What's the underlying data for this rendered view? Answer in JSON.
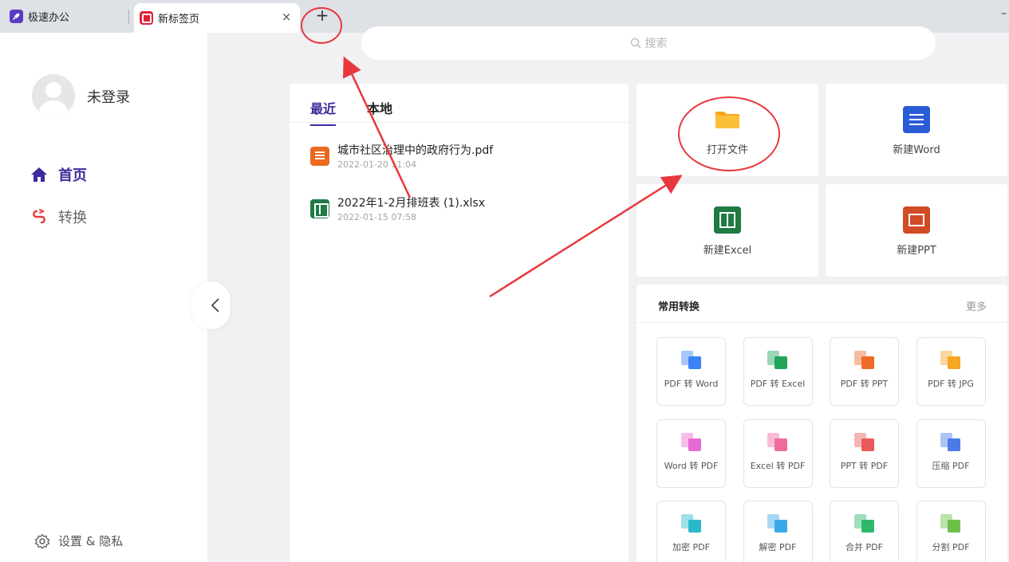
{
  "tabs": [
    {
      "label": "极速办公",
      "icon": "rocket-icon"
    },
    {
      "label": "新标签页",
      "icon": "new-tab-icon",
      "close": "×"
    }
  ],
  "tab_add": "+",
  "window_min": "–",
  "sidebar": {
    "username": "未登录",
    "nav": [
      {
        "label": "首页",
        "icon": "home-icon"
      },
      {
        "label": "转换",
        "icon": "convert-icon"
      }
    ],
    "settings_label": "设置 & 隐私"
  },
  "search": {
    "placeholder": "搜索"
  },
  "recent": {
    "tabs": [
      "最近",
      "本地"
    ],
    "files": [
      {
        "name": "城市社区治理中的政府行为.pdf",
        "date": "2022-01-20 11:04",
        "type": "pdf"
      },
      {
        "name": "2022年1-2月排班表 (1).xlsx",
        "date": "2022-01-15 07:58",
        "type": "xlsx"
      }
    ]
  },
  "actions": [
    {
      "label": "打开文件",
      "icon": "folder-icon"
    },
    {
      "label": "新建Word",
      "icon": "word-icon"
    },
    {
      "label": "新建Excel",
      "icon": "excel-icon"
    },
    {
      "label": "新建PPT",
      "icon": "ppt-icon"
    }
  ],
  "conversions": {
    "title": "常用转换",
    "more": "更多",
    "items": [
      {
        "label": "PDF 转 Word",
        "icon": "pdf-to-word-icon",
        "color": "#3b82f6"
      },
      {
        "label": "PDF 转 Excel",
        "icon": "pdf-to-excel-icon",
        "color": "#22a55a"
      },
      {
        "label": "PDF 转 PPT",
        "icon": "pdf-to-ppt-icon",
        "color": "#f06a2a"
      },
      {
        "label": "PDF 转 JPG",
        "icon": "pdf-to-jpg-icon",
        "color": "#f5a623"
      },
      {
        "label": "Word 转 PDF",
        "icon": "word-to-pdf-icon",
        "color": "#e86bd4"
      },
      {
        "label": "Excel 转 PDF",
        "icon": "excel-to-pdf-icon",
        "color": "#f06aa0"
      },
      {
        "label": "PPT 转 PDF",
        "icon": "ppt-to-pdf-icon",
        "color": "#e85a5a"
      },
      {
        "label": "压缩 PDF",
        "icon": "compress-pdf-icon",
        "color": "#4a7be8"
      },
      {
        "label": "加密 PDF",
        "icon": "encrypt-pdf-icon",
        "color": "#2ab8c8"
      },
      {
        "label": "解密 PDF",
        "icon": "decrypt-pdf-icon",
        "color": "#3aa8e8"
      },
      {
        "label": "合并 PDF",
        "icon": "merge-pdf-icon",
        "color": "#2db86a"
      },
      {
        "label": "分割 PDF",
        "icon": "split-pdf-icon",
        "color": "#6cc04a"
      }
    ]
  },
  "colors": {
    "brand": "#3e2a9c",
    "annotation_red": "#e8383d",
    "tab_bar": "#dee1e6",
    "page_bg": "#f0f1f3"
  }
}
